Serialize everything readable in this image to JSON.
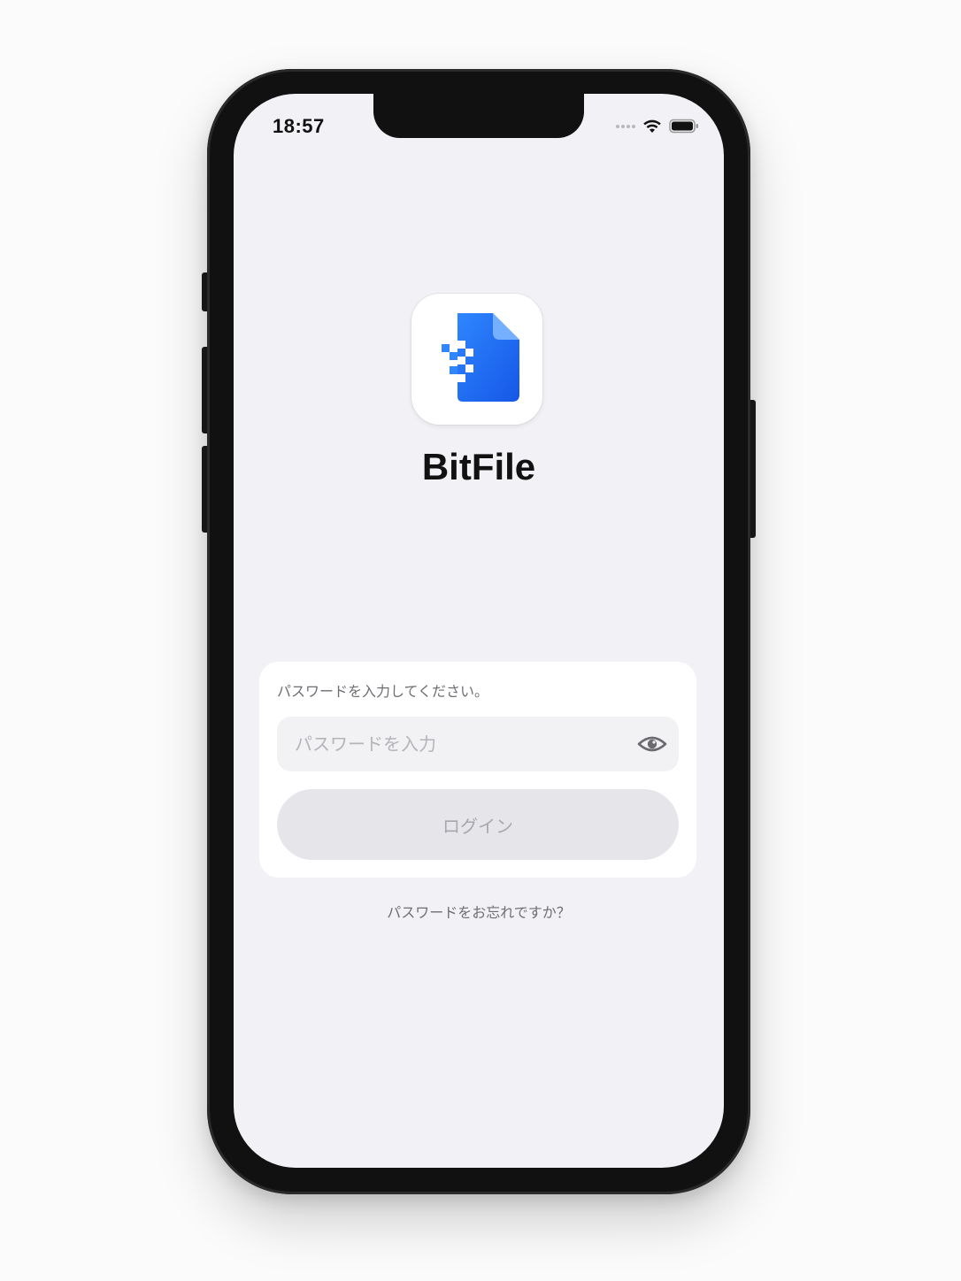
{
  "status_bar": {
    "time": "18:57"
  },
  "app": {
    "name": "BitFile",
    "icon": "bitfile-document-icon",
    "accent_color": "#1f6ff0"
  },
  "login_card": {
    "prompt": "パスワードを入力してください。",
    "password_placeholder": "パスワードを入力",
    "password_value": "",
    "visibility_icon": "eye-icon",
    "login_label": "ログイン"
  },
  "forgot_password_label": "パスワードをお忘れですか？"
}
